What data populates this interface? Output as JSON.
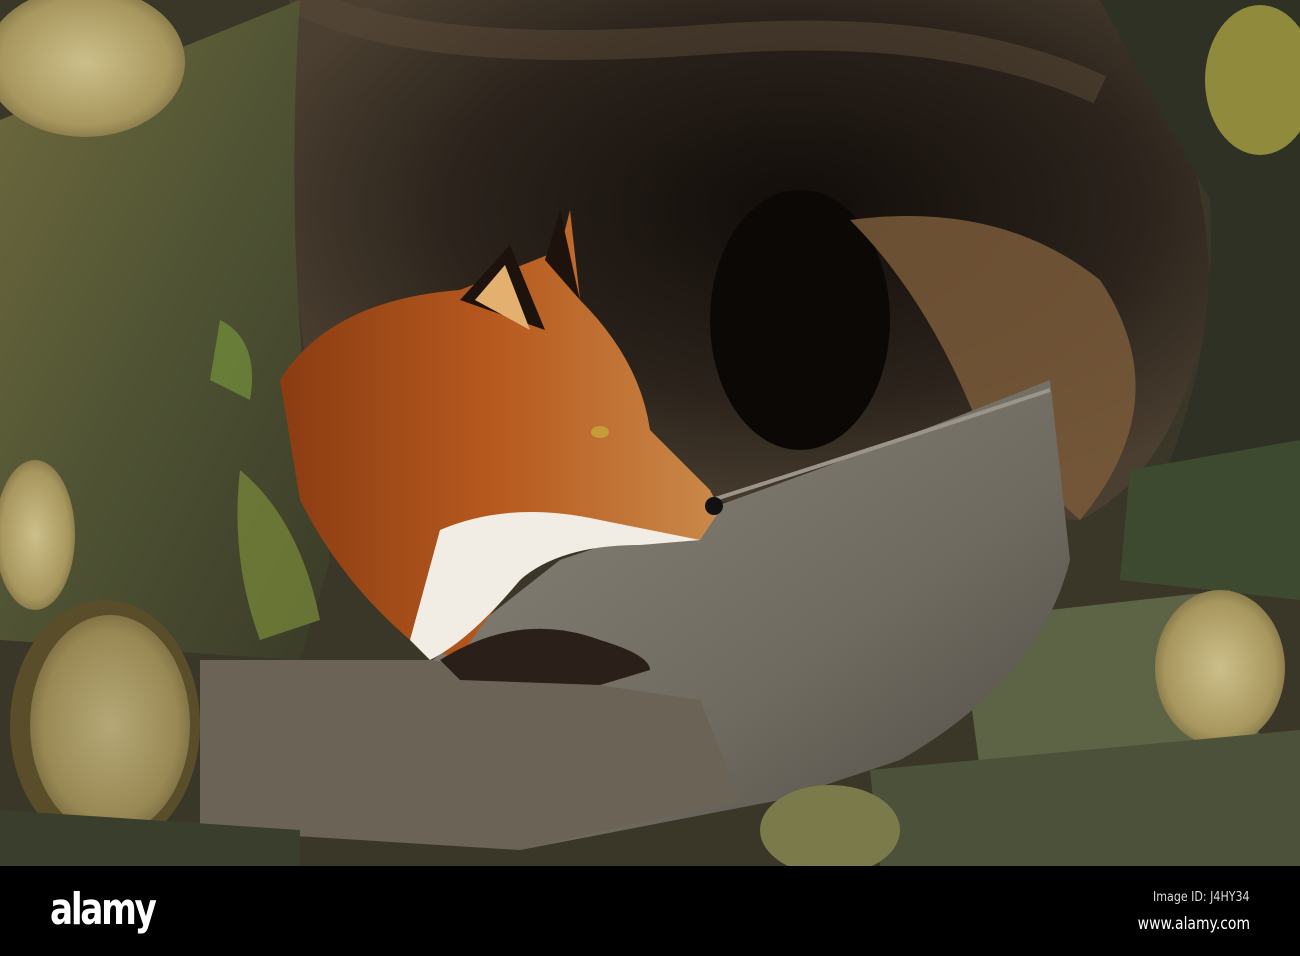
{
  "photo": {
    "subject": "red-fox",
    "watermark_text": "alamy"
  },
  "footer": {
    "logo": "alamy",
    "image_id": "Image ID: J4HY34",
    "url": "www.alamy.com"
  }
}
